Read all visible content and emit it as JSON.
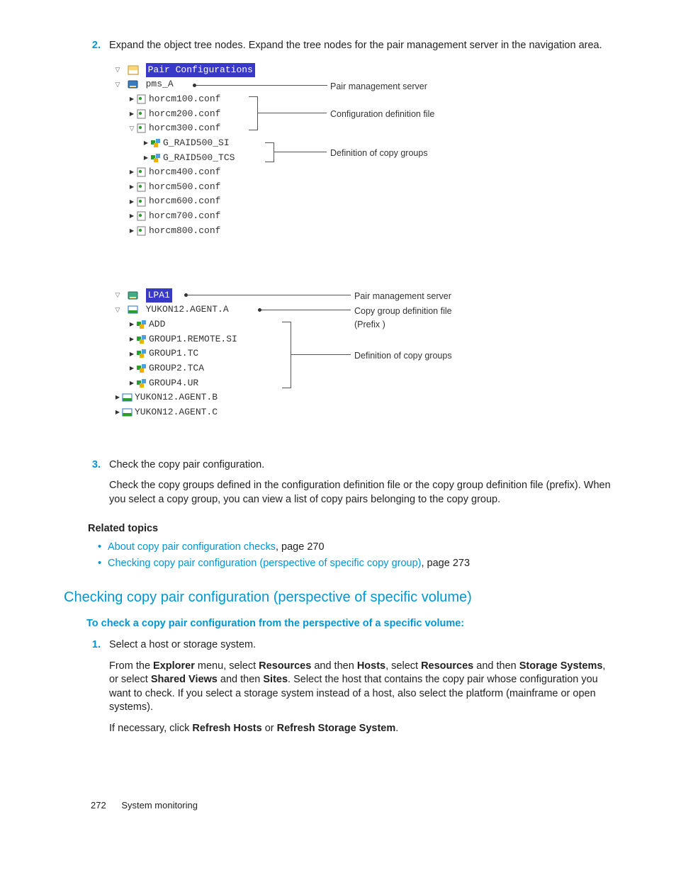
{
  "steps_top": [
    {
      "n": "2.",
      "text": "Expand the object tree nodes. Expand the tree nodes for the pair management server in the navigation area."
    }
  ],
  "tree1": {
    "root": "Pair Configurations",
    "server": "pms_A",
    "files": [
      "horcm100.conf",
      "horcm200.conf",
      "horcm300.conf",
      "horcm400.conf",
      "horcm500.conf",
      "horcm600.conf",
      "horcm700.conf",
      "horcm800.conf"
    ],
    "groups": [
      "G_RAID500_SI",
      "G_RAID500_TCS"
    ],
    "ann_server": "Pair management server",
    "ann_file": "Configuration definition file",
    "ann_groups": "Definition of copy groups"
  },
  "tree2": {
    "root": "LPA1",
    "agent_open": "YUKON12.AGENT.A",
    "groups": [
      "ADD",
      "GROUP1.REMOTE.SI",
      "GROUP1.TC",
      "GROUP2.TCA",
      "GROUP4.UR"
    ],
    "agents_closed": [
      "YUKON12.AGENT.B",
      "YUKON12.AGENT.C"
    ],
    "ann_server": "Pair management server",
    "ann_file_l1": "Copy group definition file",
    "ann_file_l2": "(Prefix )",
    "ann_groups": "Definition of copy groups"
  },
  "step3": {
    "n": "3.",
    "t": "Check the copy pair configuration.",
    "body": "Check the copy groups defined in the configuration definition file or the copy group definition file (prefix). When you select a copy group, you can view a list of copy pairs belonging to the copy group."
  },
  "related": {
    "h": "Related topics",
    "items": [
      {
        "link": "About copy pair configuration checks",
        "suffix": ", page 270"
      },
      {
        "link": "Checking copy pair configuration (perspective of specific copy group)",
        "suffix": ", page 273"
      }
    ]
  },
  "section": {
    "title": "Checking copy pair configuration (perspective of specific volume)",
    "lead": "To check a copy pair configuration from the perspective of a specific volume:"
  },
  "sec_steps": {
    "n1": "1.",
    "s1": "Select a host or storage system.",
    "p1a": "From the ",
    "p1b": " menu, select ",
    "p1c": " and then ",
    "p1d": ", select ",
    "p1e": " and then ",
    "p1f": ", or select ",
    "p1g": " and then ",
    "p1h": ". Select the host that contains the copy pair whose configuration you want to check. If you select a storage system instead of a host, also select the platform (mainframe or open systems).",
    "m_explorer": "Explorer",
    "m_resources": "Resources",
    "m_hosts": "Hosts",
    "m_storage": "Storage Systems",
    "m_shared": "Shared Views",
    "m_sites": "Sites",
    "p2a": "If necessary, click ",
    "p2b": " or ",
    "p2c": ".",
    "b_refresh_hosts": "Refresh Hosts",
    "b_refresh_ss": "Refresh Storage System"
  },
  "footer": {
    "page": "272",
    "chapter": "System monitoring"
  }
}
